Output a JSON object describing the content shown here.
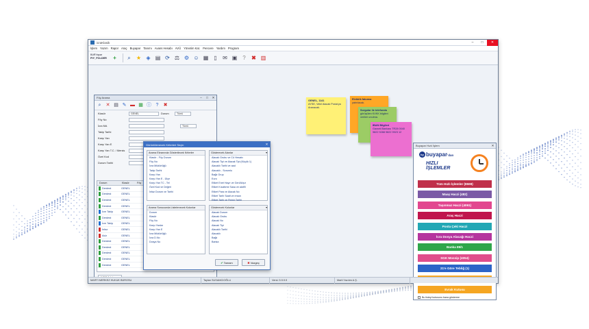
{
  "window": {
    "title": "icraKlasik"
  },
  "menu": [
    "İşlem",
    "Yazım",
    "Rapor",
    "Araç",
    "Buyapar",
    "Tanımı",
    "Avans Hesabı",
    "AVÜ",
    "Yönetim Kat.",
    "Pencere",
    "Yardım",
    "Program"
  ],
  "user": {
    "line1": "BüRYapar",
    "line2": "PIY_FOLDER"
  },
  "toolbar_icons": [
    "add-icon",
    "search-icon",
    "star-icon",
    "tag-icon",
    "print-icon",
    "refresh-icon",
    "scale-icon",
    "network-icon",
    "users-icon",
    "calculator-icon",
    "phone-icon",
    "message-icon",
    "clipboard-icon",
    "help-icon",
    "close-icon",
    "document-icon"
  ],
  "status": [
    "MARTI MERKEZ HUKUK BÜROSU",
    "Taylan SUSAMCIOĞLU",
    "Versi: 5.9.9.9",
    "Marti Yazılım A.Ş."
  ],
  "search_window": {
    "title": "Föy Arama",
    "rows": [
      {
        "label": "Klasör",
        "value": "GENEL",
        "label2": "Durum",
        "value2": "Tümü"
      },
      {
        "label": "Föy No",
        "value": "",
        "label2": "",
        "value2": ""
      },
      {
        "label": "İcra Md.",
        "value": "",
        "label2": "",
        "value2": "Tümü"
      },
      {
        "label": "Takip Tarihi",
        "value": "",
        "label2": "",
        "value2": ""
      },
      {
        "label": "Karşı Yan",
        "value": "",
        "label2": "",
        "value2": ""
      },
      {
        "label": "Karşı Yan E",
        "value": "",
        "label2": "",
        "value2": ""
      },
      {
        "label": "Karşı Yan T.C. / Mersis",
        "value": "",
        "label2": "",
        "value2": ""
      },
      {
        "label": "Özel Kod",
        "value": "",
        "label2": "",
        "value2": ""
      },
      {
        "label": "Durum Tarihi",
        "value": "",
        "label2": "",
        "value2": ""
      }
    ],
    "grid_headers": [
      "Durum",
      "Klasör",
      "Föy"
    ],
    "grid_rows": [
      {
        "status": "Derdest",
        "folder": "GENEL",
        "color": "#2e9e3e"
      },
      {
        "status": "Derdest",
        "folder": "GENEL",
        "color": "#2e9e3e"
      },
      {
        "status": "Derdest",
        "folder": "GENEL",
        "color": "#2e9e3e"
      },
      {
        "status": "Derdest",
        "folder": "GENEL",
        "color": "#2e9e3e"
      },
      {
        "status": "İcm Takip",
        "folder": "GENEL",
        "color": "#1f6fd1"
      },
      {
        "status": "Derdest",
        "folder": "GENEL",
        "color": "#2e9e3e"
      },
      {
        "status": "İcm Takip",
        "folder": "GENEL",
        "color": "#1f6fd1"
      },
      {
        "status": "İnfaz",
        "folder": "GENEL",
        "color": "#d12b2b"
      },
      {
        "status": "Aciz",
        "folder": "GENEL",
        "color": "#d12b2b"
      },
      {
        "status": "Derdest",
        "folder": "GENEL",
        "color": "#2e9e3e"
      },
      {
        "status": "Derdest",
        "folder": "GENEL",
        "color": "#2e9e3e"
      },
      {
        "status": "Derdest",
        "folder": "GENEL",
        "color": "#2e9e3e"
      },
      {
        "status": "Derdest",
        "folder": "GENEL",
        "color": "#2e9e3e"
      },
      {
        "status": "Derdest",
        "folder": "GENEL",
        "color": "#2e9e3e"
      }
    ],
    "count": "1.500 Adet"
  },
  "dialog": {
    "title": "Görüntülenecek Kriterleri Seçin",
    "panel1": {
      "title": "Arama Ekranında Gösterilecek Kriterler",
      "items": [
        "Klasör - Föy Durum",
        "Föy No",
        "İcra Müdürlüğü",
        "Takip Tarihi",
        "Karşı Yan",
        "Karşı Yan E - Ülçe",
        "Karşı Yan TC - Tel",
        "Özel Kod ve Değeri",
        "İnfaz Durum ve Tarihi"
      ]
    },
    "panel2": {
      "title": "Gösterecek Alanlar",
      "items": [
        "Alacak Grubu ve Cü Hesabı",
        "Alacak Tipi ve Alacak Tipi (Küçük 1)",
        "Alacaklı Tarihi ve aad",
        "Alacaklı - Sorumlu",
        "Bağlı Grup",
        "Euro",
        "Etiket Enet Hayır ve Geri/Alışır",
        "Etiket Kısaltımlı Sasa ve alat'lil",
        "Etiket Para ve Alacak No",
        "Etiket Tarih Saati ve ersan",
        "Etiket Tarih ve Finish Tarihi"
      ]
    },
    "panel3": {
      "title": "Arama Sonucunda Listelenecek Kolonlar",
      "items": [
        "Durum",
        "Klasör",
        "Föy No",
        "Karşı Yanlar",
        "Karşı Yan E",
        "İcra Müdürlüğü",
        "İcra D.No",
        "Dosya No"
      ]
    },
    "panel4": {
      "title": "Gösterecek Kolonlar",
      "items": [
        "Alacak Durum",
        "Alacak Grubu",
        "Alacak No",
        "Alacak Tipi",
        "Alacaklı Tarihi",
        "Alacaklı",
        "Bağlı",
        "Banka"
      ]
    },
    "ok_label": "Tamam",
    "cancel_label": "Vazgeç"
  },
  "notes": [
    {
      "title": "GENEL, 1141",
      "body": "AYSE, Vekil Alacak Posta'ya Aranacak.",
      "color": "#fff176"
    },
    {
      "title": "Elektrik faturası",
      "body": "yatırılacak.",
      "color": "#ffa726"
    },
    {
      "title": "Sorgular ile telefonda",
      "body": "görüşülen KVKK bilgileri verileri unutma.",
      "color": "#9ccc65"
    },
    {
      "title": "IBAN Bilgileri",
      "body": "Garanti Bankası TR28 0040 9822 9288 9822 9923 12",
      "color": "#ec6fd0"
    }
  ],
  "quick": {
    "title": "Buyapar Hızlı İşlem",
    "brand": "buyapar",
    "brand_suffix": "'dan",
    "subtitle_1": "HIZLI",
    "subtitle_2": "İŞLEMLER",
    "buttons": [
      {
        "label": "Tüm Hızlı İşlemler (8598)",
        "color": "#c0304a"
      },
      {
        "label": "Maaş Haczi (482)",
        "color": "#7b5aa6"
      },
      {
        "label": "Taşınmaz Haczi (4061)",
        "color": "#e2478f"
      },
      {
        "label": "Araç Haczi",
        "color": "#c0154d"
      },
      {
        "label": "Posta Çeki Haczi",
        "color": "#23a7b5"
      },
      {
        "label": "İcra Dosya Alacağı Haczi",
        "color": "#b5359e"
      },
      {
        "label": "Banka 89/1",
        "color": "#2fa64a"
      },
      {
        "label": "SGK Mossip (4054)",
        "color": "#e04e8c"
      },
      {
        "label": "21'e Göre Tebliğ (1)",
        "color": "#2b64c8"
      },
      {
        "label": "Reddiyat",
        "color": "#f5a623"
      },
      {
        "label": "Evrak Kutusu",
        "color": "#f5a623"
      }
    ],
    "checkbox_label": "Bu listeyi kutusunu bana gösterme"
  }
}
